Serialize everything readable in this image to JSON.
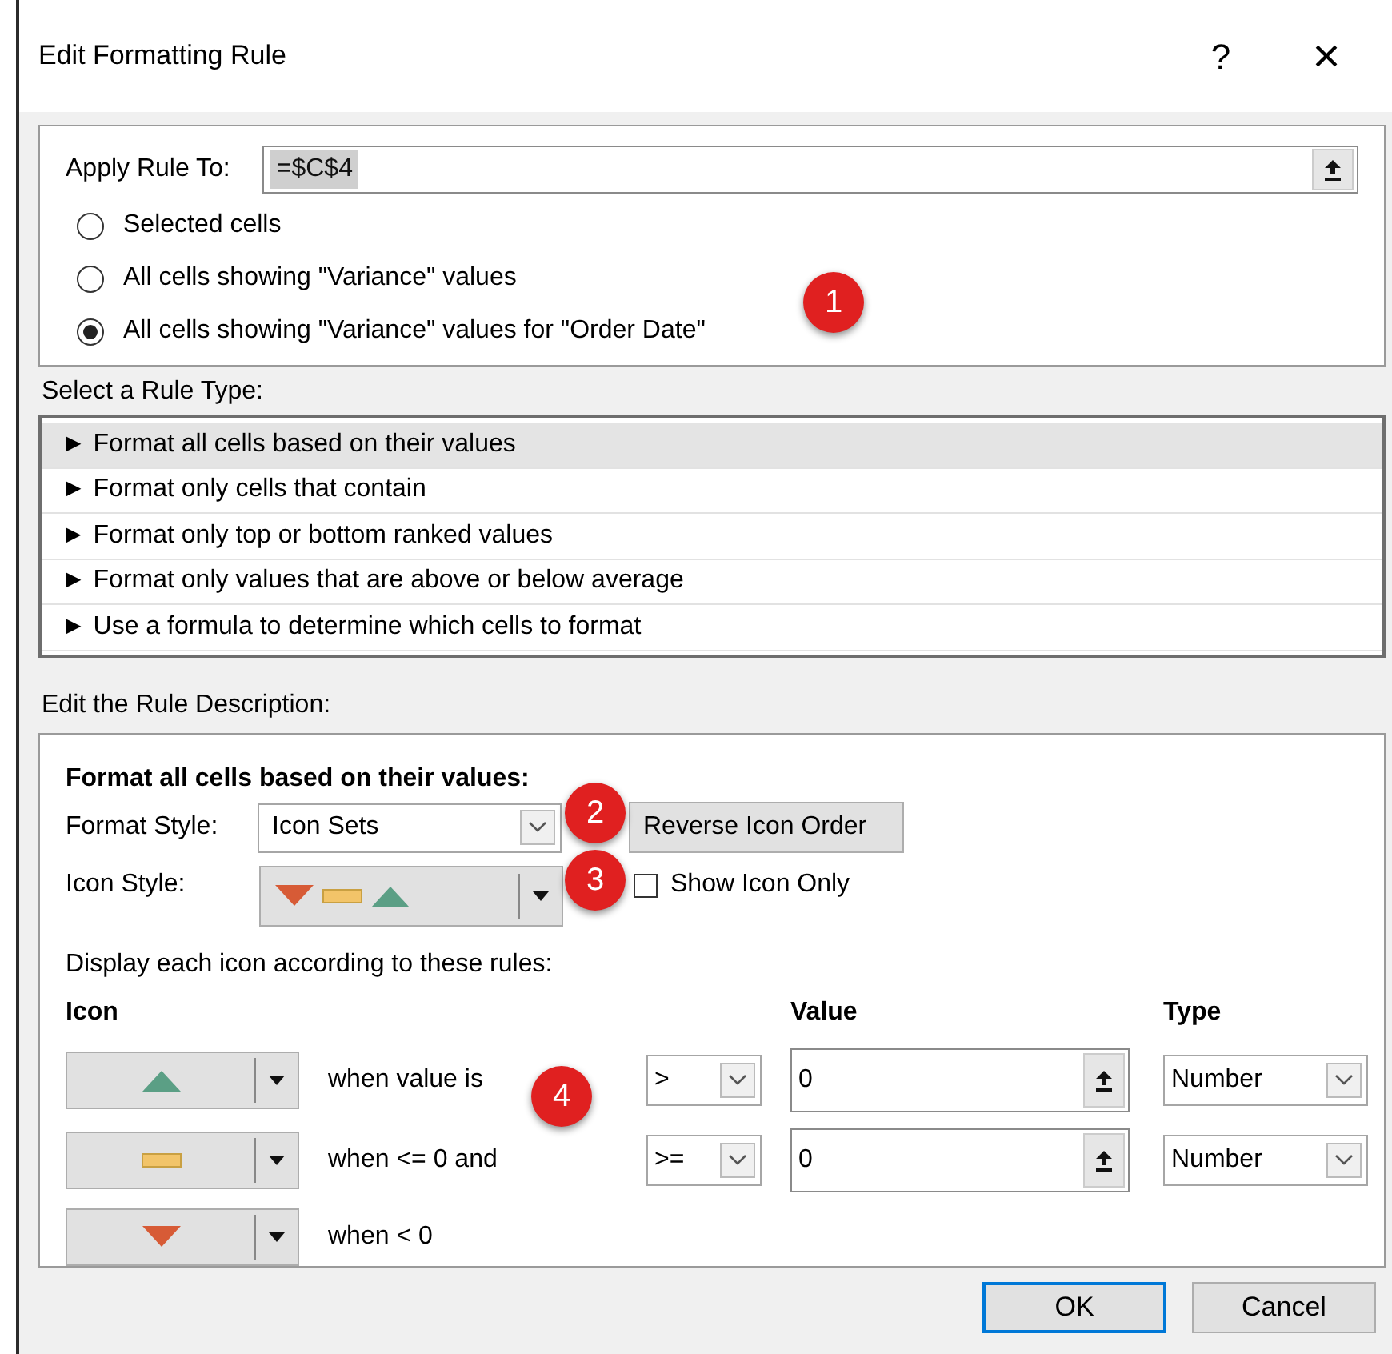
{
  "window": {
    "title": "Edit Formatting Rule",
    "help": "?",
    "close": "×"
  },
  "apply_rule_to": {
    "label": "Apply Rule To:",
    "value": "=$C$4"
  },
  "scope_options": [
    {
      "label": "Selected cells",
      "selected": false
    },
    {
      "label": "All cells showing \"Variance\" values",
      "selected": false
    },
    {
      "label": "All cells showing \"Variance\" values for \"Order Date\"",
      "selected": true
    }
  ],
  "rule_type": {
    "label": "Select a Rule Type:",
    "items": [
      {
        "bullet": "►",
        "label": "Format all cells based on their values",
        "selected": true
      },
      {
        "bullet": "►",
        "label": "Format only cells that contain",
        "selected": false
      },
      {
        "bullet": "►",
        "label": "Format only top or bottom ranked values",
        "selected": false
      },
      {
        "bullet": "►",
        "label": "Format only values that are above or below average",
        "selected": false
      },
      {
        "bullet": "►",
        "label": "Use a formula to determine which cells to format",
        "selected": false
      }
    ]
  },
  "description": {
    "label": "Edit the Rule Description:",
    "heading": "Format all cells based on their values:",
    "format_style": {
      "label": "Format Style:",
      "value": "Icon Sets"
    },
    "reverse_button": "Reverse Icon Order",
    "icon_style": {
      "label": "Icon Style:",
      "icons": [
        {
          "kind": "down",
          "color": "#d75b36"
        },
        {
          "kind": "bar",
          "color": "#f2c469"
        },
        {
          "kind": "up",
          "color": "#5b9f85"
        }
      ]
    },
    "show_icon_only": {
      "label": "Show Icon Only",
      "checked": false
    },
    "rules_caption": "Display each icon according to these rules:",
    "columns": [
      "Icon",
      "Value",
      "Type"
    ],
    "rules": [
      {
        "kind": "up",
        "color": "#5b9f85",
        "condition": "when value is",
        "operator": ">",
        "value": "0",
        "type": "Number"
      },
      {
        "kind": "bar",
        "color": "#f2c469",
        "condition": "when <= 0 and",
        "operator": ">=",
        "value": "0",
        "type": "Number"
      },
      {
        "kind": "down",
        "color": "#d75b36",
        "condition": "when < 0"
      }
    ]
  },
  "buttons": [
    {
      "label": "OK",
      "default": true
    },
    {
      "label": "Cancel",
      "default": false
    }
  ],
  "callouts": [
    {
      "label": "1"
    },
    {
      "label": "2"
    },
    {
      "label": "3"
    },
    {
      "label": "4"
    }
  ]
}
